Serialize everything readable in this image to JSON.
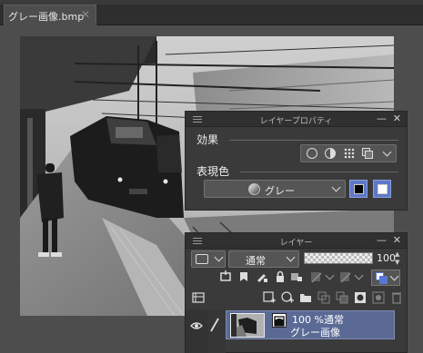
{
  "document_tab": {
    "title": "グレー画像.bmp",
    "close_icon": "close-icon"
  },
  "layer_property_panel": {
    "title": "レイヤープロパティ",
    "effect_label": "効果",
    "expression_color_label": "表現色",
    "expression_color_value": "グレー",
    "color_swatch_1": "#000000",
    "color_swatch_2": "#ffffff",
    "effect_icons": [
      "border-effect-icon",
      "tone-effect-icon",
      "halftone-icon",
      "layer-color-icon"
    ]
  },
  "layer_panel": {
    "title": "レイヤー",
    "blend_mode": "通常",
    "opacity_value": "100",
    "layer": {
      "opacity_mode": "100 %通常",
      "name": "グレー画像"
    }
  },
  "colors": {
    "background": "#4d4d4d",
    "panel_bg": "#3a3a3a",
    "selected_layer": "#5b6a95",
    "selected_accent": "#5677d4"
  }
}
